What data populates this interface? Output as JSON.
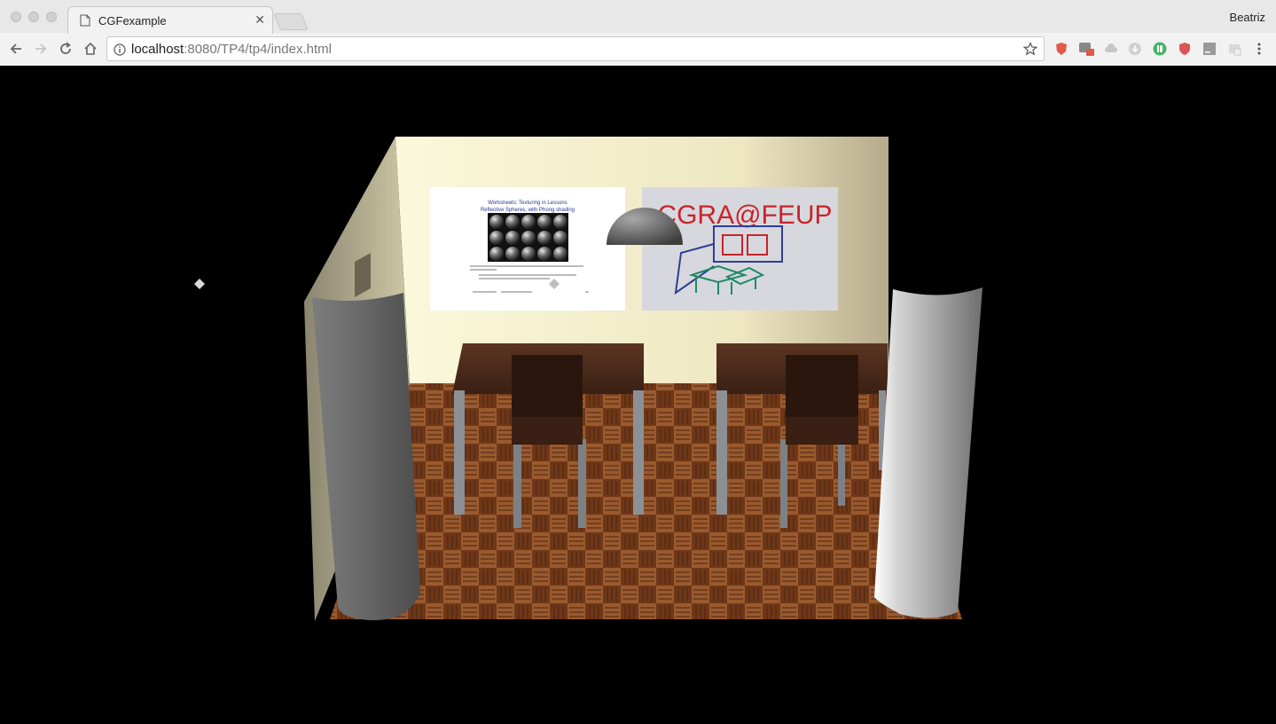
{
  "browser": {
    "tab": {
      "title": "CGFexample"
    },
    "profile_name": "Beatriz",
    "address": {
      "host": "localhost",
      "path": ":8080/TP4/tp4/index.html"
    }
  },
  "scene": {
    "poster_left": {
      "heading_line1": "Worksheets: Texturing in Lessons",
      "heading_line2": "Reflective Spheres, with Phong shading"
    },
    "poster_right": {
      "text": "CGRA@FEUP"
    }
  },
  "colors": {
    "wall": "#f4f0cf",
    "floor": "#7a3f1a",
    "table_top": "#4a2a1a",
    "leg": "#8c9094",
    "column": "#d9d9d9"
  }
}
